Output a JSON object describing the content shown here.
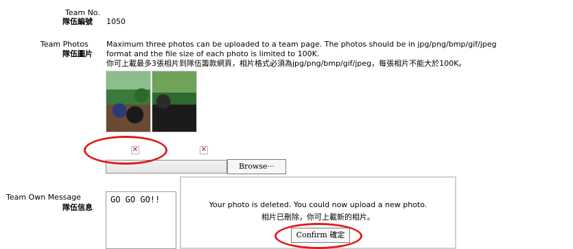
{
  "team_no": {
    "label_en": "Team No.",
    "label_zh": "隊伍編號",
    "value": "1050"
  },
  "team_photos": {
    "label_en": "Team Photos",
    "label_zh": "隊伍圖片",
    "desc_en_line1": "Maximum three photos can be uploaded to a team page. The photos should be in jpg/png/bmp/gif/jpeg",
    "desc_en_line2": "format and the file size of each photo is limited to 100K.",
    "desc_zh": "你可上載最多3張相片到隊伍籌款網頁，相片格式必須為jpg/png/bmp/gif/jpeg，每張相片不能大於100K。",
    "browse_label": "Browse···"
  },
  "team_message": {
    "label_en": "Team Own Message",
    "label_zh": "隊伍信息",
    "value": "GO GO GO!!"
  },
  "popup": {
    "message_en": "Your photo is deleted. You could now upload a new photo.",
    "message_zh": "相片已刪除，你可上載新的相片。",
    "confirm_label": "Confirm 確定"
  },
  "colors": {
    "highlight": "#e01b1b",
    "delete_icon": "#d20000"
  }
}
